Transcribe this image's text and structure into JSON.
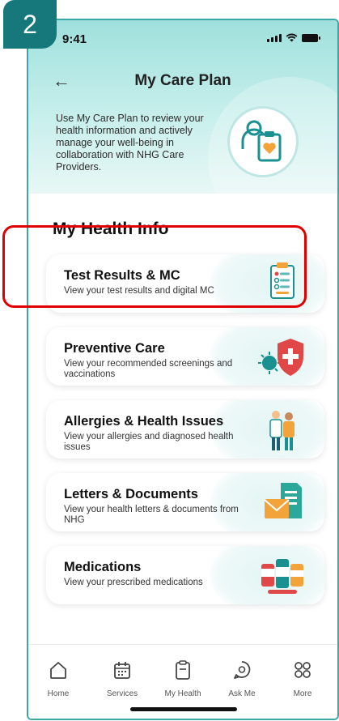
{
  "step_badge": "2",
  "status_bar": {
    "time": "9:41"
  },
  "header": {
    "title": "My Care Plan",
    "intro_text": "Use My Care Plan to review your health information and actively manage your well-being in collaboration with NHG Care Providers."
  },
  "section_title": "My Health Info",
  "cards": [
    {
      "title": "Test Results & MC",
      "subtitle": "View your test results and digital MC",
      "icon": "clipboard-icon"
    },
    {
      "title": "Preventive Care",
      "subtitle": "View your recommended screenings and vaccinations",
      "icon": "shield-virus-icon"
    },
    {
      "title": "Allergies & Health Issues",
      "subtitle": "View your allergies and diagnosed health issues",
      "icon": "doctors-icon"
    },
    {
      "title": "Letters & Documents",
      "subtitle": "View your health letters & documents from NHG",
      "icon": "document-envelope-icon"
    },
    {
      "title": "Medications",
      "subtitle": "View your prescribed medications",
      "icon": "medication-icon"
    }
  ],
  "tabbar": {
    "items": [
      {
        "label": "Home",
        "icon": "home-icon"
      },
      {
        "label": "Services",
        "icon": "calendar-icon"
      },
      {
        "label": "My Health",
        "icon": "clipboard-icon"
      },
      {
        "label": "Ask Me",
        "icon": "chat-icon"
      },
      {
        "label": "More",
        "icon": "grid-icon"
      }
    ]
  },
  "colors": {
    "accent": "#16787a",
    "highlight": "#e00000",
    "header_teal": "#9fe0dc"
  }
}
